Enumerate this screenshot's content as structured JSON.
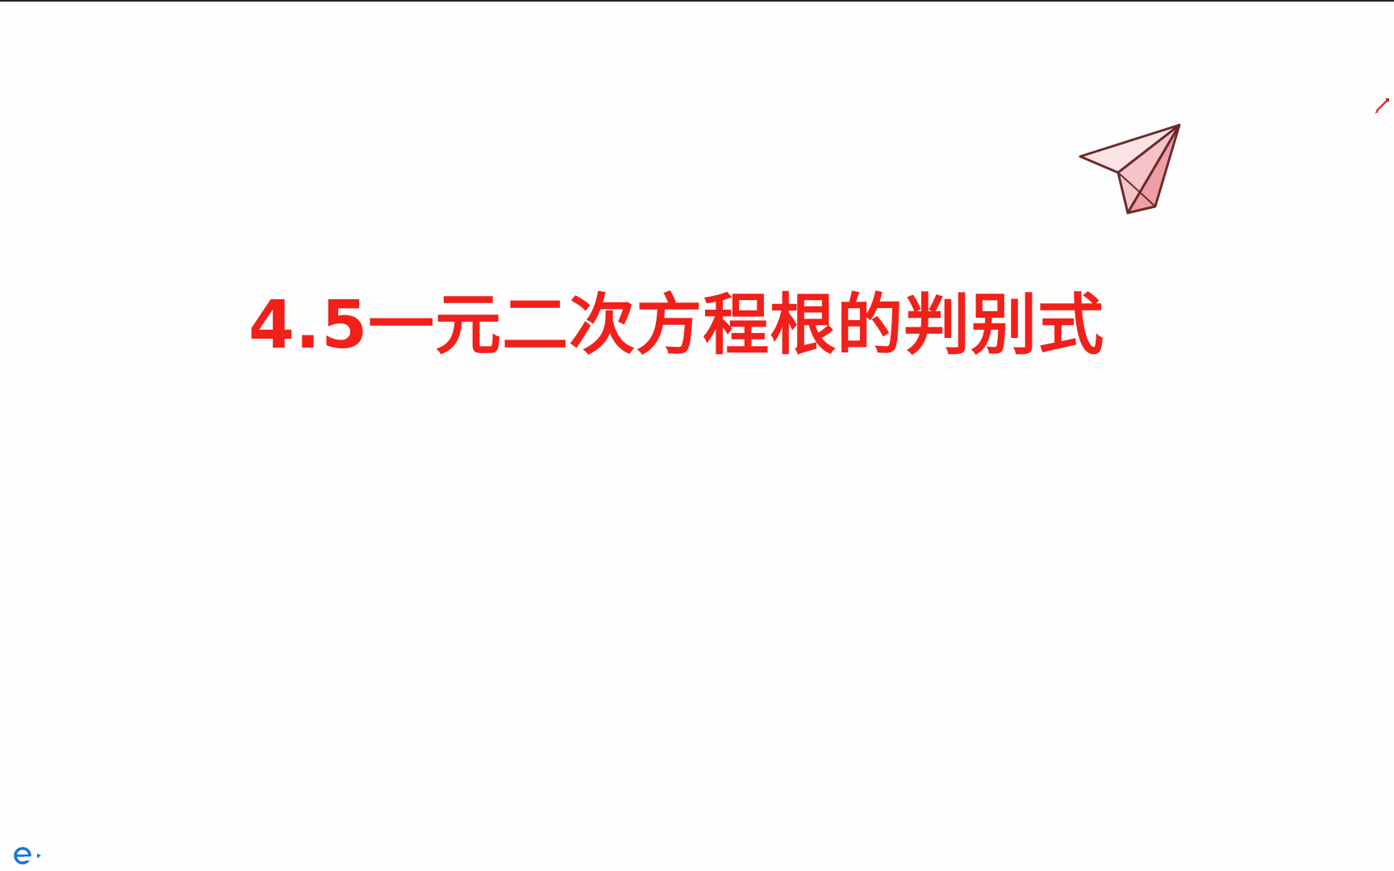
{
  "slide": {
    "title": "4.5一元二次方程根的判别式",
    "background_color": "#fefefe"
  },
  "colors": {
    "title": "#f1201a",
    "plane_fill": "#f4c4c8",
    "plane_stroke": "#6a2a2a",
    "pen": "#d9302c",
    "ie_icon": "#1a73d9"
  },
  "icons": {
    "decoration": "paper-plane-icon",
    "annotation_tool": "pen-icon",
    "taskbar_app": "internet-explorer-icon"
  }
}
